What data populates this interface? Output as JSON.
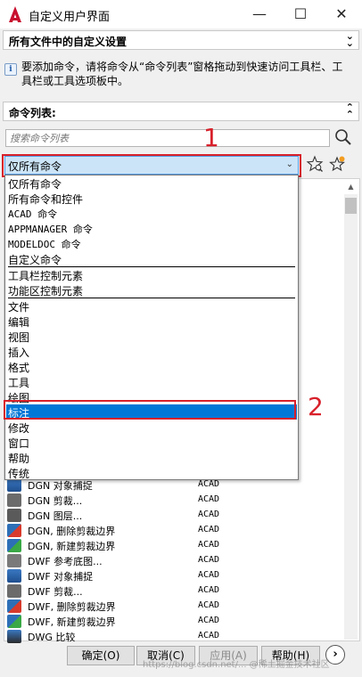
{
  "window": {
    "title": "自定义用户界面",
    "minimize": "—",
    "maximize": "☐",
    "close": "✕"
  },
  "section_all_files": {
    "label": "所有文件中的自定义设置"
  },
  "info": {
    "text": "要添加命令，请将命令从“命令列表”窗格拖动到快速访问工具栏、工具栏或工具选项板中。"
  },
  "section_commands": {
    "label": "命令列表:"
  },
  "search": {
    "placeholder": "搜索命令列表"
  },
  "filter": {
    "value": "仅所有命令"
  },
  "annotations": {
    "marker1": "1",
    "marker2": "2"
  },
  "dropdown": {
    "options": [
      "仅所有命令",
      "所有命令和控件",
      "ACAD 命令",
      "APPMANAGER 命令",
      "MODELDOC 命令",
      "自定义命令",
      "工具栏控制元素",
      "功能区控制元素",
      "文件",
      "编辑",
      "视图",
      "插入",
      "格式",
      "工具",
      "绘图",
      "标注",
      "修改",
      "窗口",
      "帮助",
      "传统"
    ],
    "selected": "标注"
  },
  "commands": [
    {
      "name": "DGN 对象捕捉",
      "source": "ACAD"
    },
    {
      "name": "DGN 剪裁...",
      "source": "ACAD"
    },
    {
      "name": "DGN 图层...",
      "source": "ACAD"
    },
    {
      "name": "DGN, 删除剪裁边界",
      "source": "ACAD"
    },
    {
      "name": "DGN, 新建剪裁边界",
      "source": "ACAD"
    },
    {
      "name": "DWF 参考底图...",
      "source": "ACAD"
    },
    {
      "name": "DWF 对象捕捉",
      "source": "ACAD"
    },
    {
      "name": "DWF 剪裁...",
      "source": "ACAD"
    },
    {
      "name": "DWF, 删除剪裁边界",
      "source": "ACAD"
    },
    {
      "name": "DWF, 新建剪裁边界",
      "source": "ACAD"
    },
    {
      "name": "DWG 比较",
      "source": "ACAD"
    }
  ],
  "buttons": {
    "ok": "确定(O)",
    "cancel": "取消(C)",
    "apply": "应用(A)",
    "help": "帮助(H)",
    "more": "›"
  },
  "watermark": "https://blog.csdn.net/... @稀土掘金技术社区",
  "colors": {
    "accent": "#0078d7",
    "annotation_red": "#d8202a",
    "app_red": "#c8102e"
  }
}
